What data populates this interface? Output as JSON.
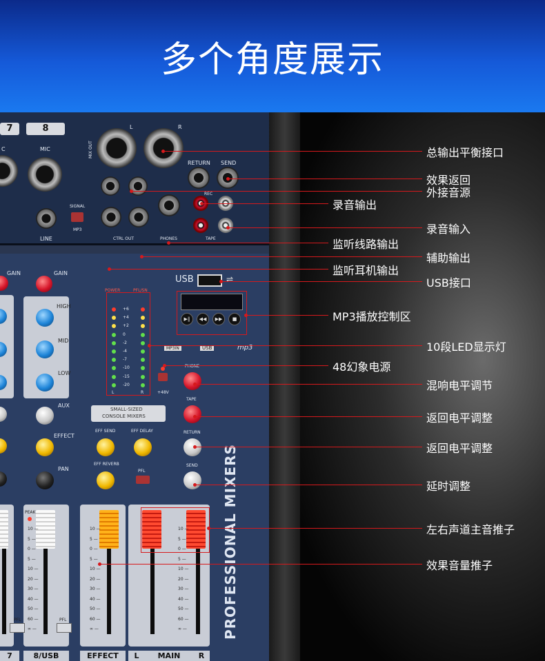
{
  "header": {
    "title": "多个角度展示"
  },
  "mixer": {
    "channels": [
      {
        "number": "7"
      },
      {
        "number": "8"
      }
    ],
    "panel_labels": {
      "mic": "MIC",
      "mic_partial": "C",
      "line": "LINE",
      "signal": "SIGNAL",
      "mp3": "MP3",
      "mix_out": "MIX OUT",
      "l": "L",
      "r": "R",
      "return": "RETURN",
      "send": "SEND",
      "rec": "REC",
      "tape": "TAPE",
      "phones": "PHONES",
      "ctrl_out": "CTRL OUT",
      "usb": "USB",
      "gain": "GAIN",
      "high": "HIGH",
      "mid": "MID",
      "low": "LOW",
      "aux": "AUX",
      "effect": "EFFECT",
      "pan": "PAN",
      "power": "POWER",
      "pflsn": "PFL/SN",
      "plus48v": "+48V",
      "phone": "PHONE",
      "small_sized": "SMALL-SIZED",
      "console_mixers": "CONSOLE MIXERS",
      "eff_send": "EFF SEND",
      "eff_delay": "EFF DELAY",
      "eff_reverb": "EFF REVERB",
      "pfl": "PFL",
      "peak": "PEAK",
      "mp3in": "MP3IN",
      "mp3_logo": "mp3",
      "professional_mixers": "PROFESSIONAL MIXERS"
    },
    "led_scale": [
      "+6",
      "+4",
      "+2",
      "0",
      "-2",
      "-4",
      "-7",
      "-10",
      "-15",
      "-20"
    ],
    "fader_scale": [
      "10",
      "5",
      "0",
      "5",
      "10",
      "20",
      "30",
      "40",
      "50",
      "60",
      "∞"
    ],
    "mp3_buttons": [
      "▶‖",
      "◀◀",
      "▶▶",
      "■"
    ],
    "bottom_labels": {
      "ch7": "7",
      "ch8": "8/USB",
      "effect": "EFFECT",
      "main_l": "L",
      "main": "MAIN",
      "main_r": "R"
    }
  },
  "callouts": [
    {
      "label": "总输出平衡接口"
    },
    {
      "label": "效果返回"
    },
    {
      "label": "外接音源"
    },
    {
      "label": "录音输出"
    },
    {
      "label": "录音输入"
    },
    {
      "label": "监听线路输出"
    },
    {
      "label": "辅助输出"
    },
    {
      "label": "监听耳机输出"
    },
    {
      "label": "USB接口"
    },
    {
      "label": "MP3播放控制区"
    },
    {
      "label": "10段LED显示灯"
    },
    {
      "label": "48幻象电源"
    },
    {
      "label": "混响电平调节"
    },
    {
      "label": "返回电平调整"
    },
    {
      "label": "返回电平调整"
    },
    {
      "label": "延时调整"
    },
    {
      "label": "左右声道主音推子"
    },
    {
      "label": "效果音量推子"
    }
  ],
  "colors": {
    "accent": "#d7191c",
    "header_top": "#0b2a8a",
    "header_bottom": "#1a79f0"
  }
}
